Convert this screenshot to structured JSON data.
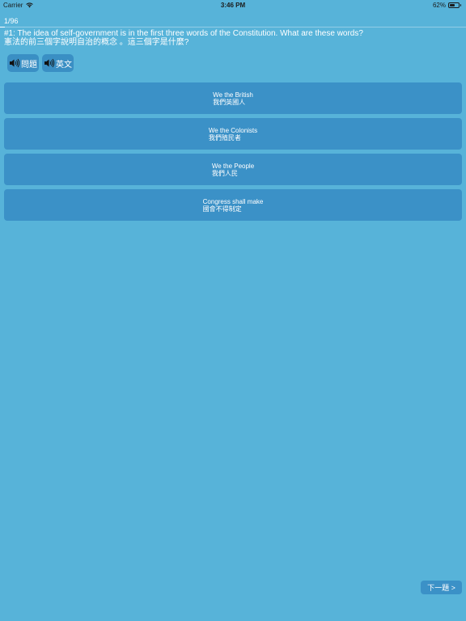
{
  "status_bar": {
    "carrier": "Carrier",
    "time": "3:46 PM",
    "battery": "62%",
    "battery_level": 0.62
  },
  "progress": {
    "label": "1/96",
    "current": 1,
    "total": 96
  },
  "question": {
    "english": "#1: The idea of self-government is in the first three words of the Constitution. What are these words?",
    "chinese": "憲法的前三個字說明自治的概念 。這三個字是什麼?"
  },
  "audio_buttons": [
    {
      "label": "問題",
      "icon": "speaker-icon"
    },
    {
      "label": "英文",
      "icon": "speaker-icon"
    }
  ],
  "answers": [
    {
      "english": "We the British",
      "chinese": "我們英國人"
    },
    {
      "english": "We the Colonists",
      "chinese": "我們殖民者"
    },
    {
      "english": "We the People",
      "chinese": "我們人民"
    },
    {
      "english": "Congress shall make",
      "chinese": "國會不得制定"
    }
  ],
  "next_button": {
    "label": "下一題 >"
  },
  "colors": {
    "background": "#57b3d9",
    "button": "#3b91c7",
    "text": "#ffffff"
  }
}
